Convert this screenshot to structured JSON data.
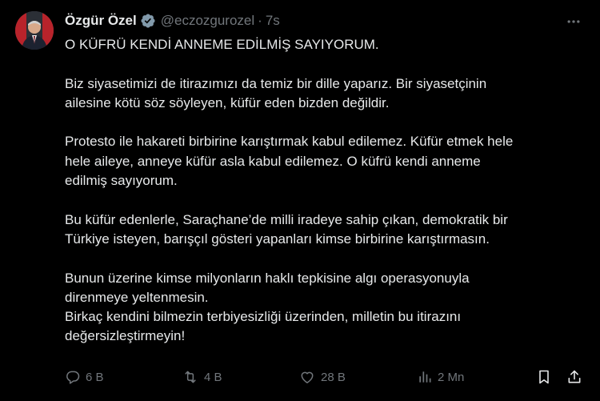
{
  "author": {
    "name": "Özgür Özel",
    "handle": "@eczozgurozel",
    "separator": "·",
    "time": "7s"
  },
  "tweet": {
    "paragraphs": [
      "O KÜFRÜ KENDİ ANNEME EDİLMİŞ SAYIYORUM.",
      "Biz siyasetimizi de itirazımızı da temiz bir dille yaparız. Bir siyasetçinin\nailesine kötü söz söyleyen, küfür eden bizden değildir.",
      "Protesto ile hakareti birbirine karıştırmak kabul edilemez. Küfür etmek hele\nhele aileye, anneye küfür asla kabul edilemez. O küfrü kendi anneme\nedilmiş sayıyorum.",
      "Bu küfür edenlerle, Saraçhane’de milli iradeye sahip çıkan, demokratik bir\nTürkiye isteyen, barışçıl gösteri yapanları kimse birbirine karıştırmasın.",
      "Bunun üzerine kimse milyonların haklı tepkisine algı operasyonuyla\ndirenmeye yeltenmesin.\nBirkaç kendini bilmezin terbiyesizliği üzerinden, milletin bu itirazını\ndeğersizleştirmeyin!"
    ]
  },
  "actions": {
    "replies": "6 B",
    "retweets": "4 B",
    "likes": "28 B",
    "views": "2 Mn"
  },
  "icons": {
    "verified": "verified-badge-icon",
    "more": "more-dots-icon",
    "reply": "reply-icon",
    "retweet": "retweet-icon",
    "like": "heart-icon",
    "views": "views-chart-icon",
    "bookmark": "bookmark-icon",
    "share": "share-icon"
  },
  "colors": {
    "background": "#000000",
    "text": "#e7e9ea",
    "secondary": "#71767b",
    "verified_badge": "#829aab"
  }
}
